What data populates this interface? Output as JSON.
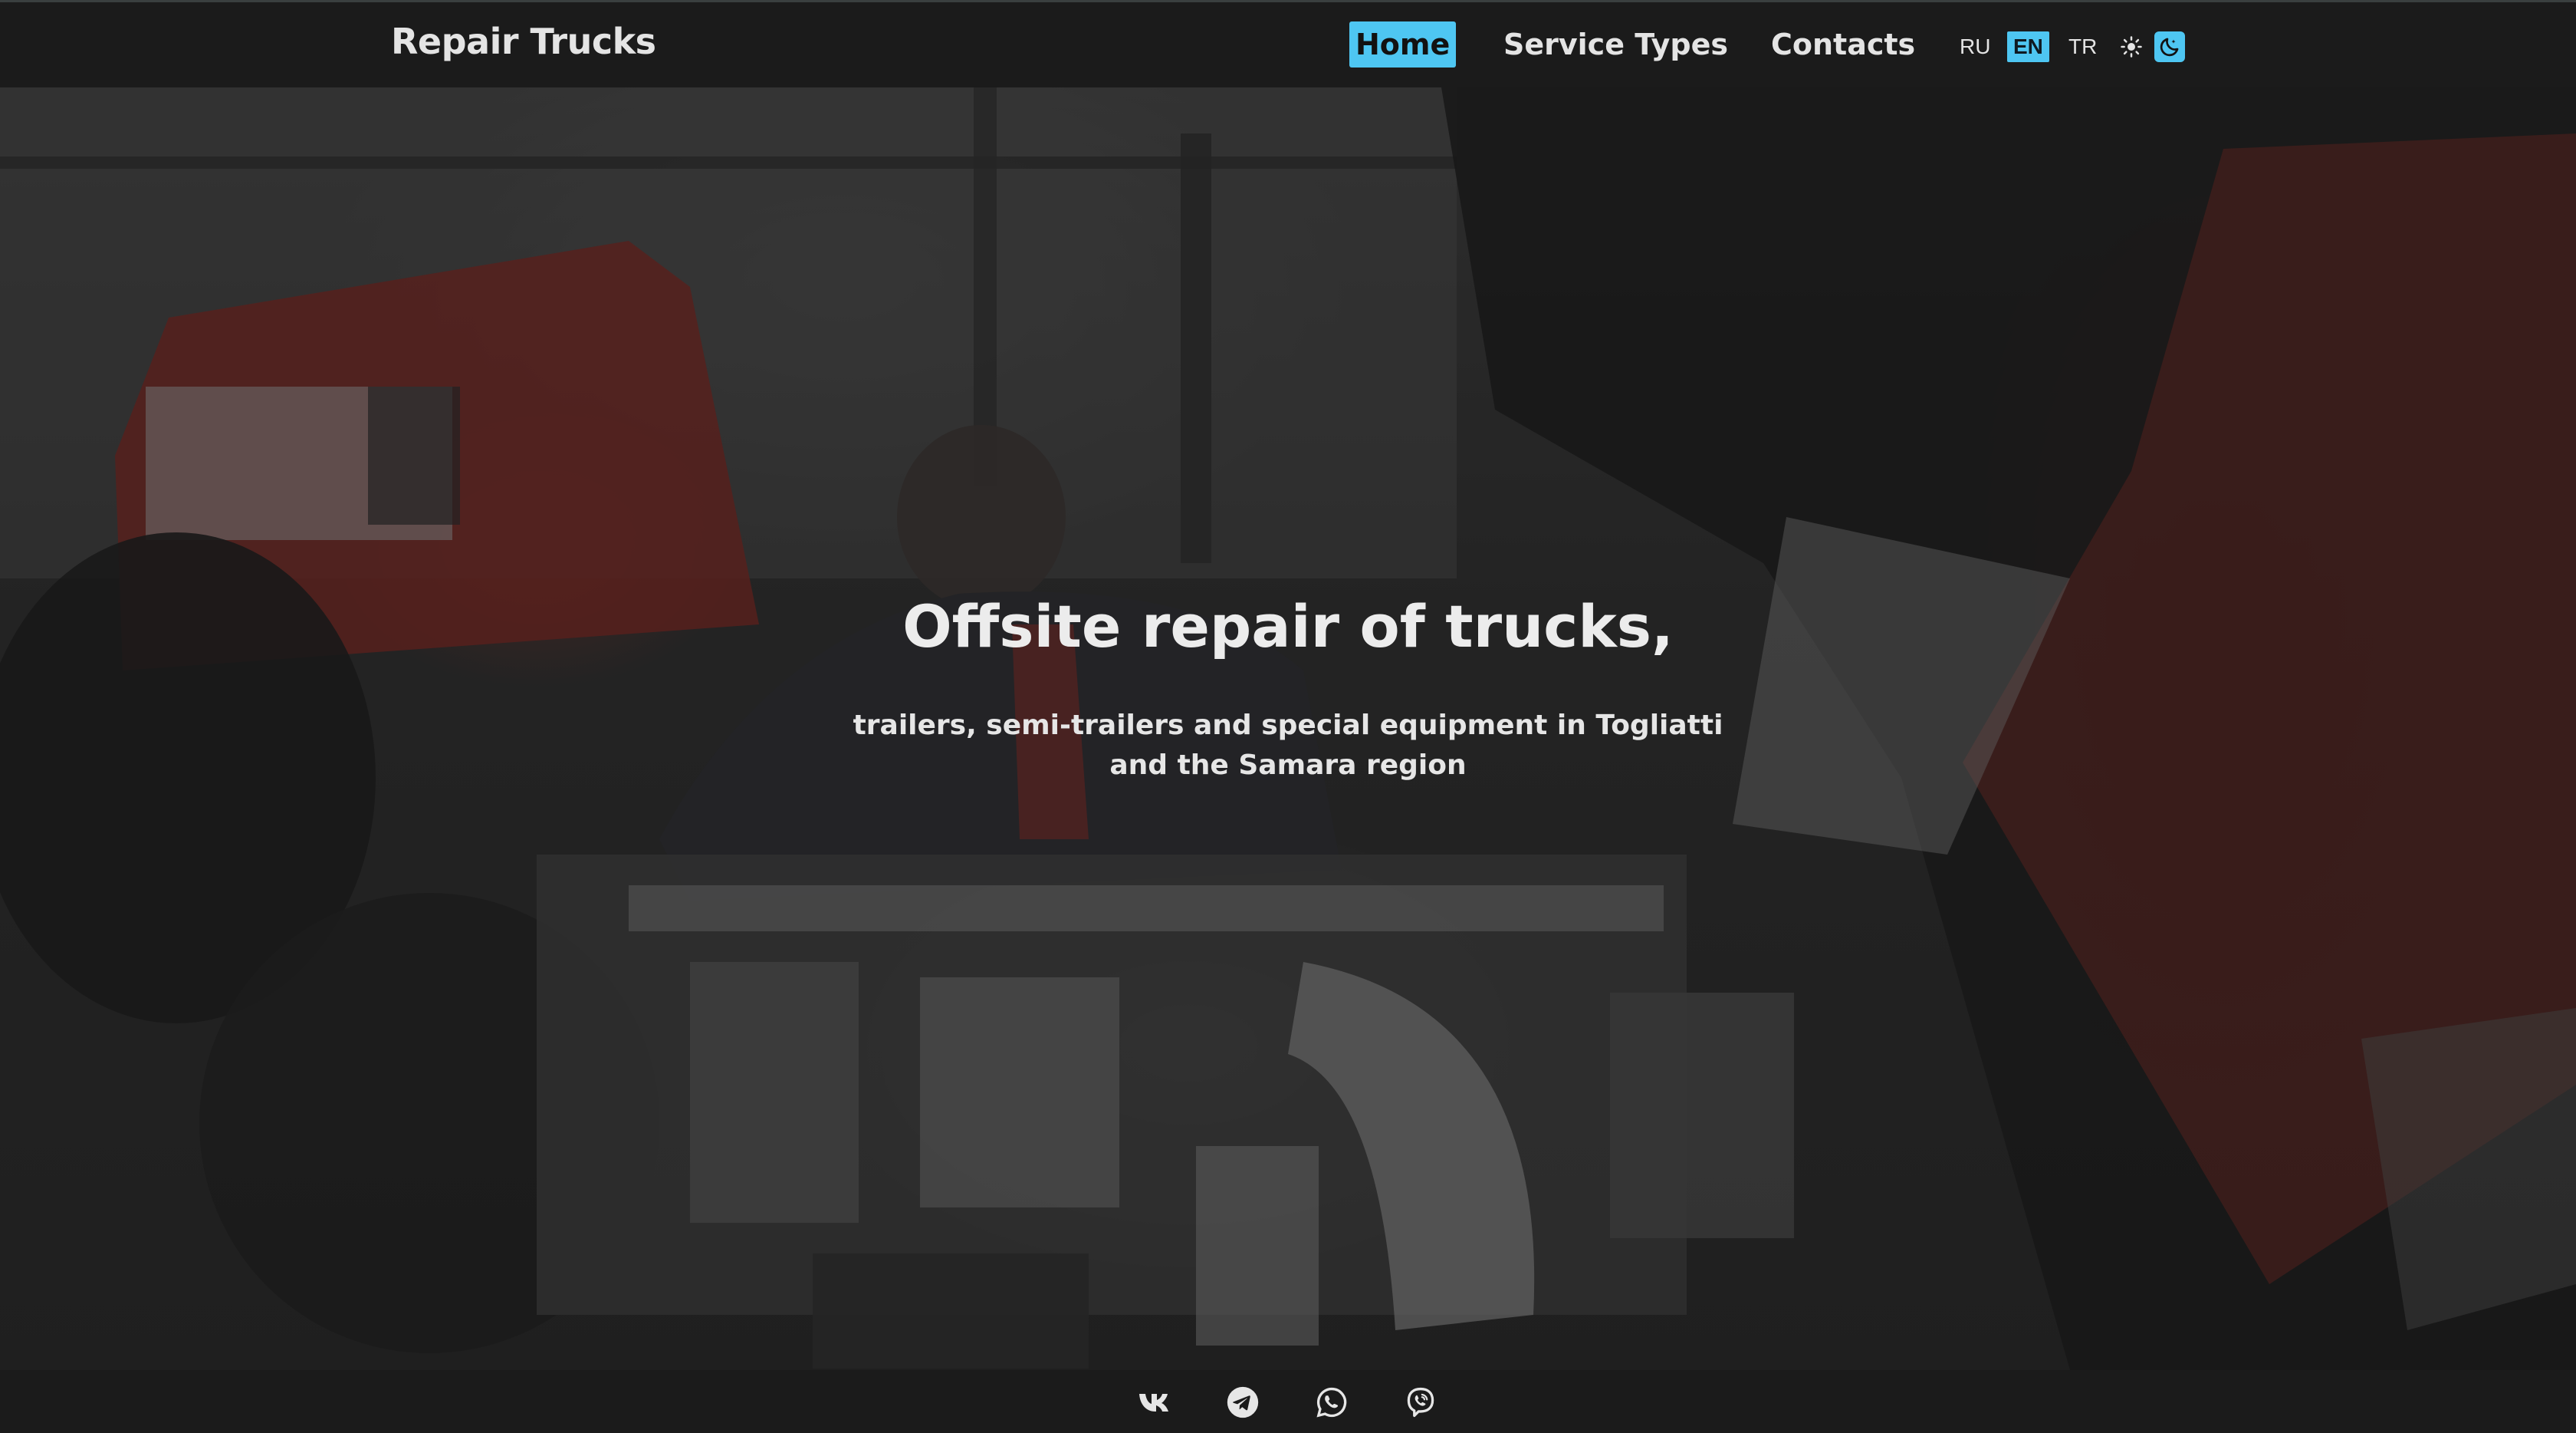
{
  "header": {
    "brand": "Repair Trucks",
    "nav": [
      {
        "label": "Home",
        "active": true
      },
      {
        "label": "Service Types",
        "active": false
      },
      {
        "label": "Contacts",
        "active": false
      }
    ],
    "languages": [
      {
        "label": "RU",
        "active": false
      },
      {
        "label": "EN",
        "active": true
      },
      {
        "label": "TR",
        "active": false
      }
    ],
    "theme_toggle": {
      "light_icon": "sun-icon",
      "dark_icon": "moon-icon",
      "active": "dark"
    }
  },
  "hero": {
    "title": "Offsite repair of trucks,",
    "subtitle": "trailers, semi-trailers and special equipment in Togliatti and the Samara region",
    "background_image": "mechanic repairing truck engine"
  },
  "footer": {
    "social": [
      {
        "icon": "vk-icon"
      },
      {
        "icon": "telegram-icon"
      },
      {
        "icon": "whatsapp-icon"
      },
      {
        "icon": "viber-icon"
      }
    ]
  },
  "colors": {
    "accent": "#4ec6f2",
    "header_bg": "#1b1b1b",
    "text": "#e4e4e4"
  }
}
